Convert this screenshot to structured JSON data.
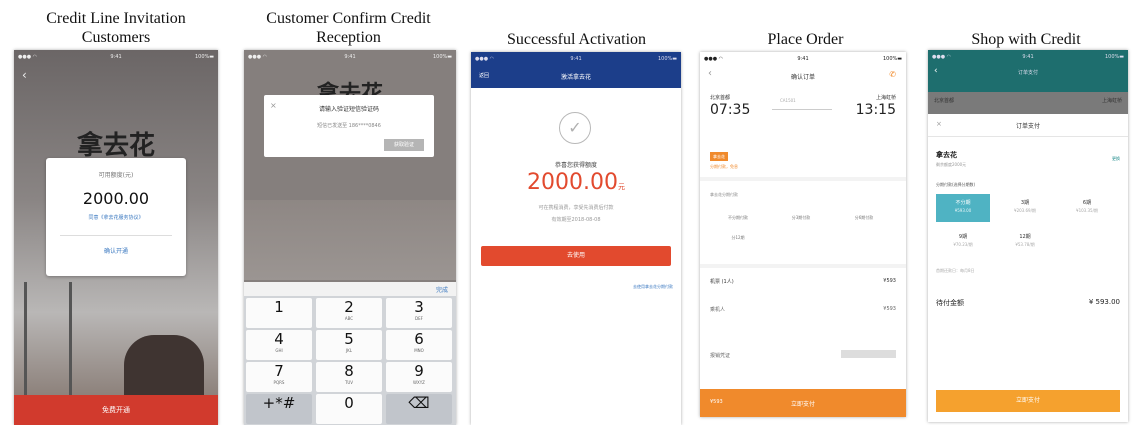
{
  "captions": [
    "Credit Line Invitation\nCustomers",
    "Customer Confirm Credit\nReception",
    "Successful Activation",
    "Place Order",
    "Shop with Credit"
  ],
  "brand": "拿去花",
  "invitation": {
    "card_label": "可用额度(元)",
    "amount": "2000.00",
    "terms": "同意《拿去花服务协议》",
    "open_link": "确认开通",
    "bottom_button": "免费开通",
    "accent": "#d13a2d"
  },
  "confirm": {
    "dialog_title": "请输入验证短信验证码",
    "dialog_sub": "短信已发送至 186****0846",
    "dialog_button": "获取验证",
    "dismiss": "完成",
    "keys": [
      {
        "n": "1",
        "l": ""
      },
      {
        "n": "2",
        "l": "ABC"
      },
      {
        "n": "3",
        "l": "DEF"
      },
      {
        "n": "4",
        "l": "GHI"
      },
      {
        "n": "5",
        "l": "JKL"
      },
      {
        "n": "6",
        "l": "MNO"
      },
      {
        "n": "7",
        "l": "PQRS"
      },
      {
        "n": "8",
        "l": "TUV"
      },
      {
        "n": "9",
        "l": "WXYZ"
      },
      {
        "n": "+*#",
        "l": ""
      },
      {
        "n": "0",
        "l": ""
      },
      {
        "n": "⌫",
        "l": ""
      }
    ]
  },
  "activation": {
    "nav_back": "返回",
    "nav_title": "激活拿去花",
    "success_label": "恭喜您获得额度",
    "amount": "2000.00",
    "amount_unit": "元",
    "desc1": "可在携程消费，享受先消费后付款",
    "desc2": "有效期至2018-08-08",
    "button": "去使用",
    "link": "去使用拿去花分期付款",
    "nav_color": "#1c3e8a",
    "accent": "#e24a2e"
  },
  "order": {
    "title": "确认订单",
    "dep_city": "北京首都",
    "dep_time": "07:35",
    "arr_city": "上海虹桥",
    "arr_time": "13:15",
    "flight": "CA1501",
    "tag": "拿去花",
    "tag_note": "分期付款，免息",
    "section": "拿去花分期付款",
    "plans": [
      "不分期付款",
      "分3期付款",
      "分6期付款",
      "分12期"
    ],
    "price_label": "机票 (1人)",
    "price": "¥593",
    "insurance": "乘机人",
    "insurance_val": "¥593",
    "remark": "报销凭证",
    "pay_total": "¥593",
    "pay_button": "立即支付",
    "accent": "#f08a2c"
  },
  "shop": {
    "header": "订单支付",
    "dep_city": "北京首都",
    "arr_city": "上海虹桥",
    "sheet_title": "订单支付",
    "method": "拿去花",
    "method_sub": "剩余额度2000元",
    "method_link": "更换",
    "plan_title": "分期付款(选择分期数)",
    "plans": [
      {
        "title": "不分期",
        "sub": "¥593.00"
      },
      {
        "title": "3期",
        "sub": "¥203.69/期"
      },
      {
        "title": "6期",
        "sub": "¥103.35/期"
      },
      {
        "title": "9期",
        "sub": "¥70.23/期"
      },
      {
        "title": "12期",
        "sub": "¥53.78/期"
      }
    ],
    "plan_note": "首期还款日：每月8日",
    "total_label": "待付金额",
    "total": "¥ 593.00",
    "button": "立即支付",
    "teal": "#1e8a8a",
    "accent": "#f5a12e"
  }
}
